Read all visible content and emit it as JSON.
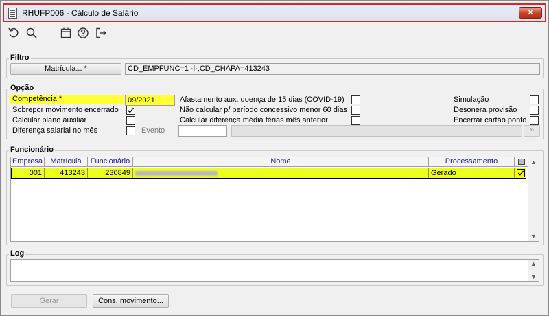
{
  "window": {
    "title": "RHUFP006 - Cálculo de Salário",
    "close_glyph": "✕"
  },
  "toolbar": {
    "buttons": [
      {
        "name": "refresh-icon"
      },
      {
        "name": "search-icon"
      },
      {
        "name": "calendar-icon"
      },
      {
        "name": "help-icon"
      },
      {
        "name": "exit-icon"
      }
    ]
  },
  "filtro": {
    "legend": "Filtro",
    "matricula_button": "Matrícula... *",
    "filter_value": "CD_EMPFUNC=1 ·l·;CD_CHAPA=413243",
    "ellipsis": "..."
  },
  "opcao": {
    "legend": "Opção",
    "competencia_label": "Competência *",
    "competencia_value": "09/2021",
    "sobrepor_label": "Sobrepor movimento encerrado",
    "sobrepor_checked": true,
    "calcular_plano_label": "Calcular plano auxiliar",
    "diferenca_label": "Diferença salarial no mês",
    "evento_label": "Evento",
    "evento_btn": "»",
    "afastamento_label": "Afastamento aux. doença de 15 dias (COVID-19)",
    "nao_calcular_label": "Não calcular p/ período concessivo menor 60 dias",
    "calcular_dif_label": "Calcular diferença média férias mês anterior",
    "simulacao_label": "Simulação",
    "desonera_label": "Desonera provisão",
    "encerrar_label": "Encerrar cartão ponto"
  },
  "funcionario": {
    "legend": "Funcionário",
    "columns": [
      "Empresa",
      "Matrícula",
      "Funcionário",
      "Nome",
      "Processamento"
    ],
    "rows": [
      {
        "empresa": "001",
        "matricula": "413243",
        "funcionario": "230849",
        "nome": "",
        "processamento": "Gerado",
        "checked": true
      }
    ]
  },
  "log": {
    "legend": "Log"
  },
  "footer": {
    "gerar": "Gerar",
    "cons_movimento": "Cons. movimento..."
  },
  "colors": {
    "highlight": "#ffff33",
    "row_highlight": "#ecff22",
    "title_border": "#d9252a"
  }
}
